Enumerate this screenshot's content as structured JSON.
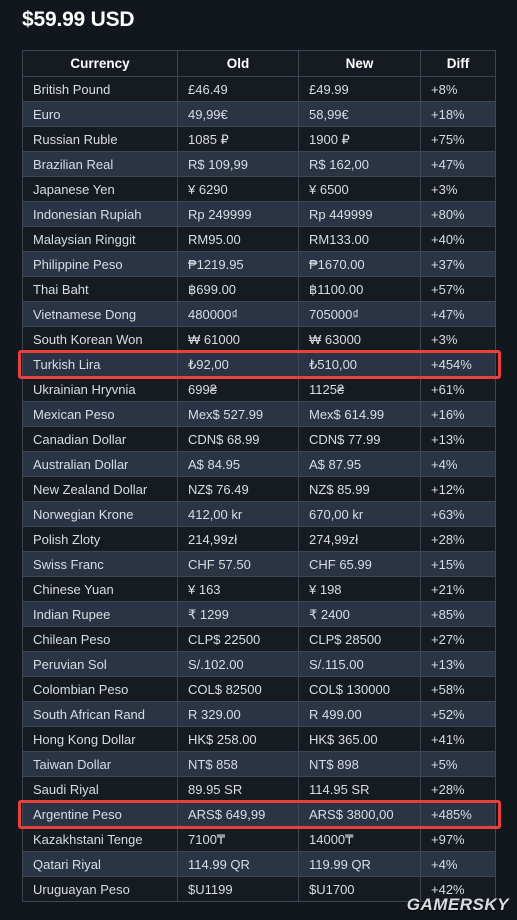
{
  "page": {
    "title": "$59.99 USD",
    "watermark": "GAMERSKY",
    "accent_highlight_color": "#e8413c",
    "background_color": "#12161d",
    "row_dark_color": "#161b22",
    "row_light_color": "#2b3445",
    "border_color": "#3c4654"
  },
  "table": {
    "columns": [
      "Currency",
      "Old",
      "New",
      "Diff"
    ],
    "rows": [
      {
        "currency": "British Pound",
        "old": "£46.49",
        "new": "£49.99",
        "diff": "+8%",
        "highlight": false
      },
      {
        "currency": "Euro",
        "old": "49,99€",
        "new": "58,99€",
        "diff": "+18%",
        "highlight": false
      },
      {
        "currency": "Russian Ruble",
        "old": "1085 ₽",
        "new": "1900 ₽",
        "diff": "+75%",
        "highlight": false
      },
      {
        "currency": "Brazilian Real",
        "old": "R$ 109,99",
        "new": "R$ 162,00",
        "diff": "+47%",
        "highlight": false
      },
      {
        "currency": "Japanese Yen",
        "old": "¥ 6290",
        "new": "¥ 6500",
        "diff": "+3%",
        "highlight": false
      },
      {
        "currency": "Indonesian Rupiah",
        "old": "Rp 249999",
        "new": "Rp 449999",
        "diff": "+80%",
        "highlight": false
      },
      {
        "currency": "Malaysian Ringgit",
        "old": "RM95.00",
        "new": "RM133.00",
        "diff": "+40%",
        "highlight": false
      },
      {
        "currency": "Philippine Peso",
        "old": "₱1219.95",
        "new": "₱1670.00",
        "diff": "+37%",
        "highlight": false
      },
      {
        "currency": "Thai Baht",
        "old": "฿699.00",
        "new": "฿1100.00",
        "diff": "+57%",
        "highlight": false
      },
      {
        "currency": "Vietnamese Dong",
        "old": "480000₫",
        "new": "705000₫",
        "diff": "+47%",
        "highlight": false
      },
      {
        "currency": "South Korean Won",
        "old": "₩ 61000",
        "new": "₩ 63000",
        "diff": "+3%",
        "highlight": false
      },
      {
        "currency": "Turkish Lira",
        "old": "₺92,00",
        "new": "₺510,00",
        "diff": "+454%",
        "highlight": true
      },
      {
        "currency": "Ukrainian Hryvnia",
        "old": "699₴",
        "new": "1125₴",
        "diff": "+61%",
        "highlight": false
      },
      {
        "currency": "Mexican Peso",
        "old": "Mex$ 527.99",
        "new": "Mex$ 614.99",
        "diff": "+16%",
        "highlight": false
      },
      {
        "currency": "Canadian Dollar",
        "old": "CDN$ 68.99",
        "new": "CDN$ 77.99",
        "diff": "+13%",
        "highlight": false
      },
      {
        "currency": "Australian Dollar",
        "old": "A$ 84.95",
        "new": "A$ 87.95",
        "diff": "+4%",
        "highlight": false
      },
      {
        "currency": "New Zealand Dollar",
        "old": "NZ$ 76.49",
        "new": "NZ$ 85.99",
        "diff": "+12%",
        "highlight": false
      },
      {
        "currency": "Norwegian Krone",
        "old": "412,00 kr",
        "new": "670,00 kr",
        "diff": "+63%",
        "highlight": false
      },
      {
        "currency": "Polish Zloty",
        "old": "214,99zł",
        "new": "274,99zł",
        "diff": "+28%",
        "highlight": false
      },
      {
        "currency": "Swiss Franc",
        "old": "CHF 57.50",
        "new": "CHF 65.99",
        "diff": "+15%",
        "highlight": false
      },
      {
        "currency": "Chinese Yuan",
        "old": "¥ 163",
        "new": "¥ 198",
        "diff": "+21%",
        "highlight": false
      },
      {
        "currency": "Indian Rupee",
        "old": "₹ 1299",
        "new": "₹ 2400",
        "diff": "+85%",
        "highlight": false
      },
      {
        "currency": "Chilean Peso",
        "old": "CLP$ 22500",
        "new": "CLP$ 28500",
        "diff": "+27%",
        "highlight": false
      },
      {
        "currency": "Peruvian Sol",
        "old": "S/.102.00",
        "new": "S/.115.00",
        "diff": "+13%",
        "highlight": false
      },
      {
        "currency": "Colombian Peso",
        "old": "COL$ 82500",
        "new": "COL$ 130000",
        "diff": "+58%",
        "highlight": false
      },
      {
        "currency": "South African Rand",
        "old": "R 329.00",
        "new": "R 499.00",
        "diff": "+52%",
        "highlight": false
      },
      {
        "currency": "Hong Kong Dollar",
        "old": "HK$ 258.00",
        "new": "HK$ 365.00",
        "diff": "+41%",
        "highlight": false
      },
      {
        "currency": "Taiwan Dollar",
        "old": "NT$ 858",
        "new": "NT$ 898",
        "diff": "+5%",
        "highlight": false
      },
      {
        "currency": "Saudi Riyal",
        "old": "89.95 SR",
        "new": "114.95 SR",
        "diff": "+28%",
        "highlight": false
      },
      {
        "currency": "Argentine Peso",
        "old": "ARS$ 649,99",
        "new": "ARS$ 3800,00",
        "diff": "+485%",
        "highlight": true
      },
      {
        "currency": "Kazakhstani Tenge",
        "old": "7100₸",
        "new": "14000₸",
        "diff": "+97%",
        "highlight": false
      },
      {
        "currency": "Qatari Riyal",
        "old": "114.99 QR",
        "new": "119.99 QR",
        "diff": "+4%",
        "highlight": false
      },
      {
        "currency": "Uruguayan Peso",
        "old": "$U1199",
        "new": "$U1700",
        "diff": "+42%",
        "highlight": false
      }
    ]
  }
}
